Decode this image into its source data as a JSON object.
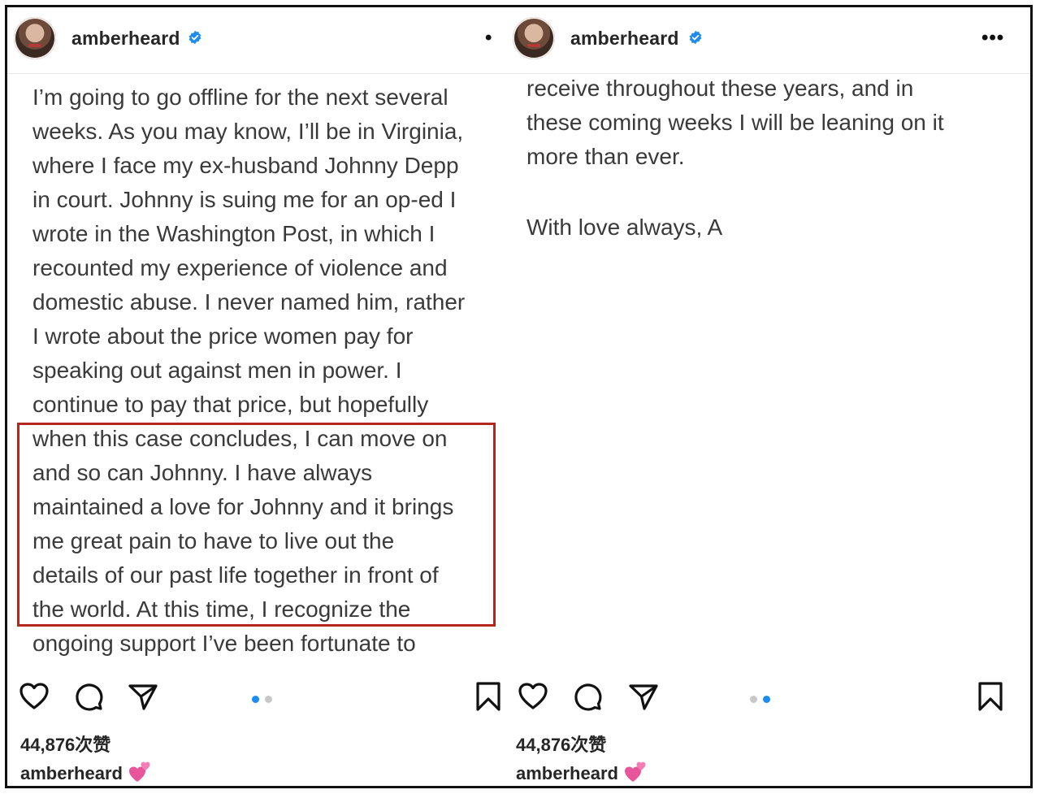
{
  "posts": [
    {
      "username": "amberheard",
      "menu_label": "•",
      "text_lines": [
        "I’m going to go offline for the next several",
        "weeks. As you may know,  I’ll be in Virginia,",
        "where I face my ex-husband Johnny Depp",
        "in court. Johnny is suing me for an op-ed I",
        "wrote in the Washington Post, in which I",
        "recounted my experience of violence and",
        "domestic abuse. I never named him, rather",
        "I wrote about the price women pay for",
        "speaking out against men in power. I",
        "continue to pay that price, but hopefully",
        "when this case concludes, I can move on",
        "and so can Johnny. I have always",
        "maintained a love for Johnny and it brings",
        "me great pain to have to live out the",
        "details of our past life together in front of",
        "the world. At this time, I recognize the",
        "ongoing support I’ve been fortunate to"
      ],
      "likes": "44,876次赞",
      "caption_user": "amberheard",
      "caption_emoji": "two-hearts-emoji",
      "carousel_active_index": 0
    },
    {
      "username": "amberheard",
      "menu_label": "•••",
      "text_lines": [
        "receive throughout these years, and in",
        "these coming weeks I will be leaning on it",
        "more than ever.",
        "",
        "With love always, A"
      ],
      "likes": "44,876次赞",
      "caption_user": "amberheard",
      "caption_emoji": "two-hearts-emoji",
      "carousel_active_index": 1
    }
  ],
  "colors": {
    "highlight_border": "#b3261e",
    "verified_badge": "#1d8cf0",
    "dot_active": "#1d8cf0",
    "dot_inactive": "#c8c8c8",
    "emoji_pink": "#e8559b"
  },
  "icons": [
    "verified-badge-icon",
    "heart-icon",
    "comment-icon",
    "share-icon",
    "bookmark-icon",
    "more-options-icon"
  ]
}
